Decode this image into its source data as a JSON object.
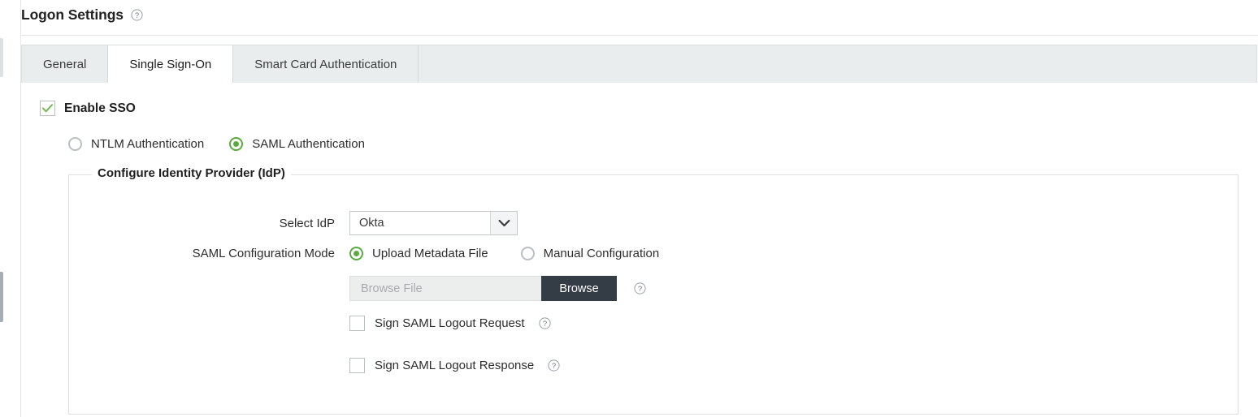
{
  "header": {
    "title": "Logon Settings",
    "help_icon": "help-circle-icon"
  },
  "tabs": [
    {
      "label": "General",
      "active": false
    },
    {
      "label": "Single Sign-On",
      "active": true
    },
    {
      "label": "Smart Card Authentication",
      "active": false
    }
  ],
  "content": {
    "enable_sso": {
      "label": "Enable SSO",
      "checked": true,
      "check_icon": "check-mark-icon"
    },
    "auth_type": {
      "selected": "SAML Authentication",
      "options": [
        {
          "label": "NTLM Authentication",
          "selected": false
        },
        {
          "label": "SAML Authentication",
          "selected": true
        }
      ]
    },
    "idp_fieldset": {
      "legend": "Configure Identity Provider (IdP)",
      "select_idp": {
        "label": "Select IdP",
        "value": "Okta",
        "arrow_icon": "chevron-down-icon"
      },
      "saml_configuration_mode": {
        "label": "SAML Configuration Mode",
        "options": [
          {
            "label": "Upload Metadata File",
            "selected": true
          },
          {
            "label": "Manual Configuration",
            "selected": false
          }
        ]
      },
      "browse": {
        "placeholder": "Browse File",
        "value": "",
        "button_label": "Browse",
        "help_icon": "help-circle-icon"
      },
      "sign_logout_request": {
        "label": "Sign SAML Logout Request",
        "checked": false,
        "help_icon": "help-circle-icon"
      },
      "sign_logout_response": {
        "label": "Sign SAML Logout Response",
        "checked": false,
        "help_icon": "help-circle-icon"
      }
    }
  },
  "colors": {
    "accent_green": "#5aab3f",
    "button_dark": "#343c46",
    "tab_bar_bg": "#e9eded"
  }
}
